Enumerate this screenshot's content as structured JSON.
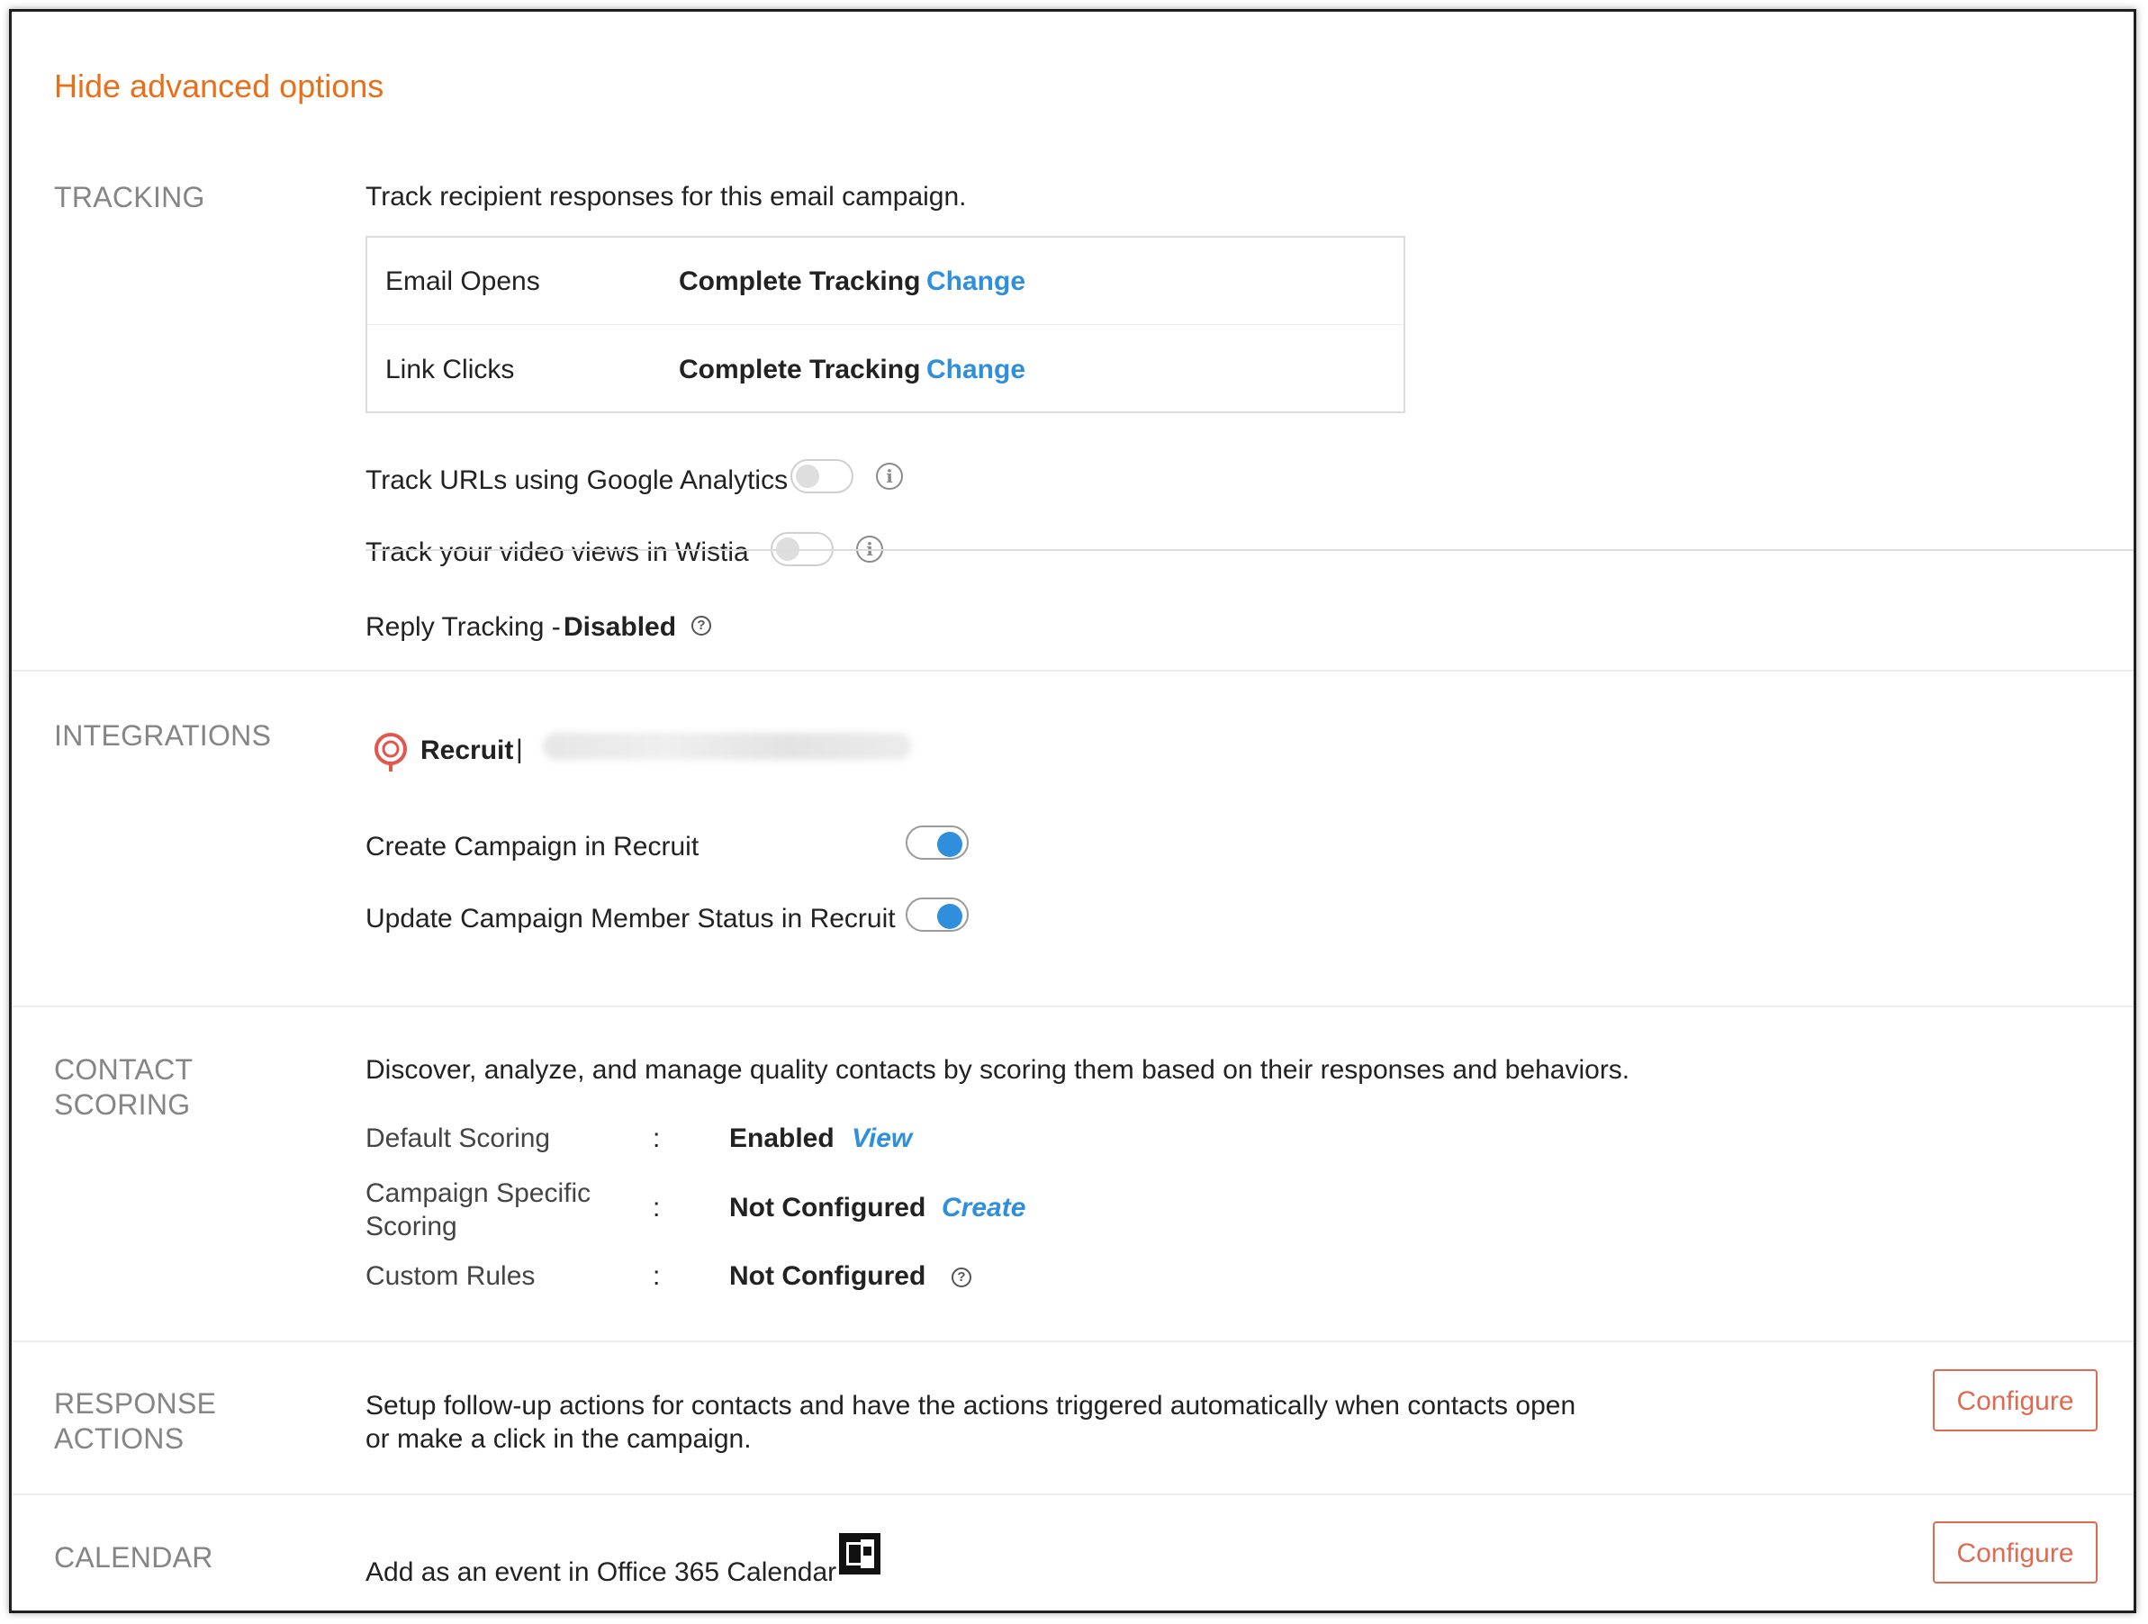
{
  "advanced_toggle": "Hide advanced options",
  "tracking": {
    "label": "TRACKING",
    "description": "Track recipient responses for this email campaign.",
    "rows": [
      {
        "name": "Email Opens",
        "value": "Complete Tracking",
        "action": "Change"
      },
      {
        "name": "Link Clicks",
        "value": "Complete Tracking",
        "action": "Change"
      }
    ],
    "google_analytics": {
      "label": "Track URLs using Google Analytics",
      "enabled": false
    },
    "wistia": {
      "label": "Track your video views in Wistia",
      "enabled": false
    },
    "reply": {
      "label": "Reply Tracking -",
      "value": "Disabled"
    }
  },
  "integrations": {
    "label": "INTEGRATIONS",
    "app_name": "Recruit",
    "separator": "|",
    "options": [
      {
        "label": "Create Campaign in Recruit",
        "enabled": true
      },
      {
        "label": "Update Campaign Member Status in Recruit",
        "enabled": true
      }
    ]
  },
  "contact_scoring": {
    "label_line1": "CONTACT",
    "label_line2": "SCORING",
    "description": "Discover, analyze, and manage quality contacts by scoring them based on their responses and behaviors.",
    "colon": ":",
    "rows": [
      {
        "name": "Default Scoring",
        "value": "Enabled",
        "action": "View"
      },
      {
        "name_line1": "Campaign Specific",
        "name_line2": "Scoring",
        "value": "Not Configured",
        "action": "Create"
      },
      {
        "name": "Custom Rules",
        "value": "Not Configured"
      }
    ]
  },
  "response_actions": {
    "label_line1": "RESPONSE",
    "label_line2": "ACTIONS",
    "description_line1": "Setup follow-up actions for contacts and have the actions triggered automatically when contacts open",
    "description_line2": "or make a click in the campaign.",
    "button": "Configure"
  },
  "calendar": {
    "label": "CALENDAR",
    "description": "Add as an event in Office 365 Calendar",
    "button": "Configure"
  },
  "colors": {
    "accent_orange": "#e8701a",
    "link_blue": "#2f8fdd",
    "button_red": "#e06a50",
    "label_grey": "#858585"
  },
  "icons": [
    "info-icon",
    "help-icon",
    "recruit-logo-icon",
    "office365-calendar-icon"
  ]
}
